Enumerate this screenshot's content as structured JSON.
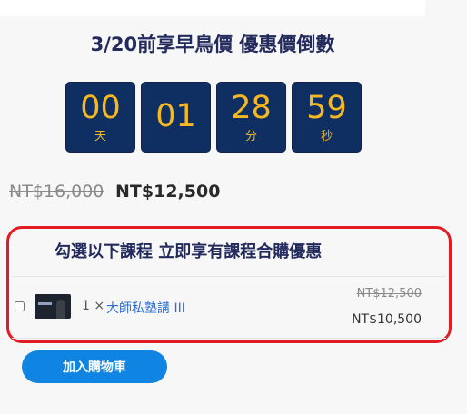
{
  "promo": {
    "title": "3/20前享早鳥價 優惠價倒數"
  },
  "countdown": [
    {
      "value": "00",
      "unit": "天"
    },
    {
      "value": "01",
      "unit": ""
    },
    {
      "value": "28",
      "unit": "分"
    },
    {
      "value": "59",
      "unit": "秒"
    }
  ],
  "price": {
    "original": "NT$16,000",
    "sale": "NT$12,500"
  },
  "bundle": {
    "title": "勾選以下課程 立即享有課程合購優惠",
    "items": [
      {
        "checked": false,
        "quantity": "1 ×",
        "name": "大師私塾講 III",
        "original_price": "NT$12,500",
        "sale_price": "NT$10,500"
      }
    ]
  },
  "actions": {
    "add_to_cart": "加入購物車"
  },
  "colors": {
    "countdown_bg": "#0f2f63",
    "countdown_text": "#f6b820",
    "highlight_border": "#e31b23",
    "button": "#0f84e3",
    "link": "#2f6fd0"
  }
}
